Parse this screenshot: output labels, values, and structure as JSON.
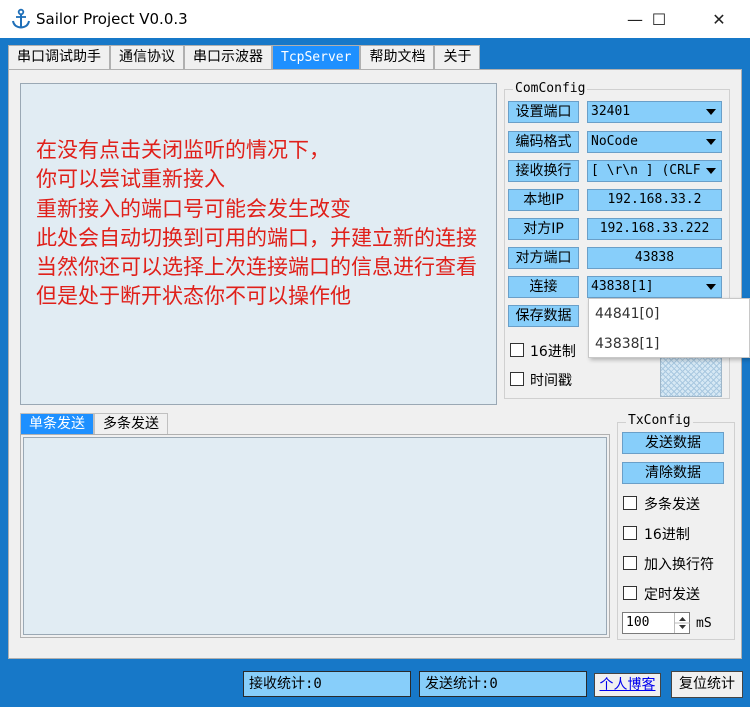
{
  "window": {
    "title": "Sailor Project V0.0.3",
    "controls": {
      "minimize": "—",
      "maximize": "☐",
      "close": "✕"
    }
  },
  "tabs": [
    {
      "label": "串口调试助手"
    },
    {
      "label": "通信协议"
    },
    {
      "label": "串口示波器"
    },
    {
      "label": "TcpServer",
      "active": true
    },
    {
      "label": "帮助文档"
    },
    {
      "label": "关于"
    }
  ],
  "overlay_text": [
    "在没有点击关闭监听的情况下，",
    "你可以尝试重新接入",
    "重新接入的端口号可能会发生改变",
    "此处会自动切换到可用的端口，并建立新的连接",
    "当然你还可以选择上次连接端口的信息进行查看",
    "但是处于断开状态你不可以操作他"
  ],
  "comconfig": {
    "title": "ComConfig",
    "set_port_label": "设置端口",
    "set_port_value": "32401",
    "encoding_label": "编码格式",
    "encoding_value": "NoCode",
    "newline_label": "接收换行",
    "newline_value": "[ \\r\\n ] (CRLF)",
    "local_ip_label": "本地IP",
    "local_ip_value": "192.168.33.2",
    "remote_ip_label": "对方IP",
    "remote_ip_value": "192.168.33.222",
    "remote_port_label": "对方端口",
    "remote_port_value": "43838",
    "connection_label": "连接",
    "connection_value": "43838[1]",
    "save_data_label": "保存数据",
    "hex_label": "16进制",
    "timestamp_label": "时间戳",
    "dropdown_options": [
      "44841[0]",
      "43838[1]"
    ]
  },
  "send_tabs": [
    {
      "label": "单条发送",
      "active": true
    },
    {
      "label": "多条发送"
    }
  ],
  "txconfig": {
    "title": "TxConfig",
    "send_label": "发送数据",
    "clear_label": "清除数据",
    "multi_send_label": "多条发送",
    "hex_label": "16进制",
    "add_newline_label": "加入换行符",
    "timed_send_label": "定时发送",
    "interval_value": "100",
    "interval_unit": "mS"
  },
  "statusbar": {
    "recv_count": "接收统计:0",
    "send_count": "发送统计:0",
    "blog_link": "个人博客",
    "reset_label": "复位统计"
  },
  "colors": {
    "accent_blue": "#1778c8",
    "control_blue": "#87cefa",
    "overlay_red": "#e0201a"
  }
}
